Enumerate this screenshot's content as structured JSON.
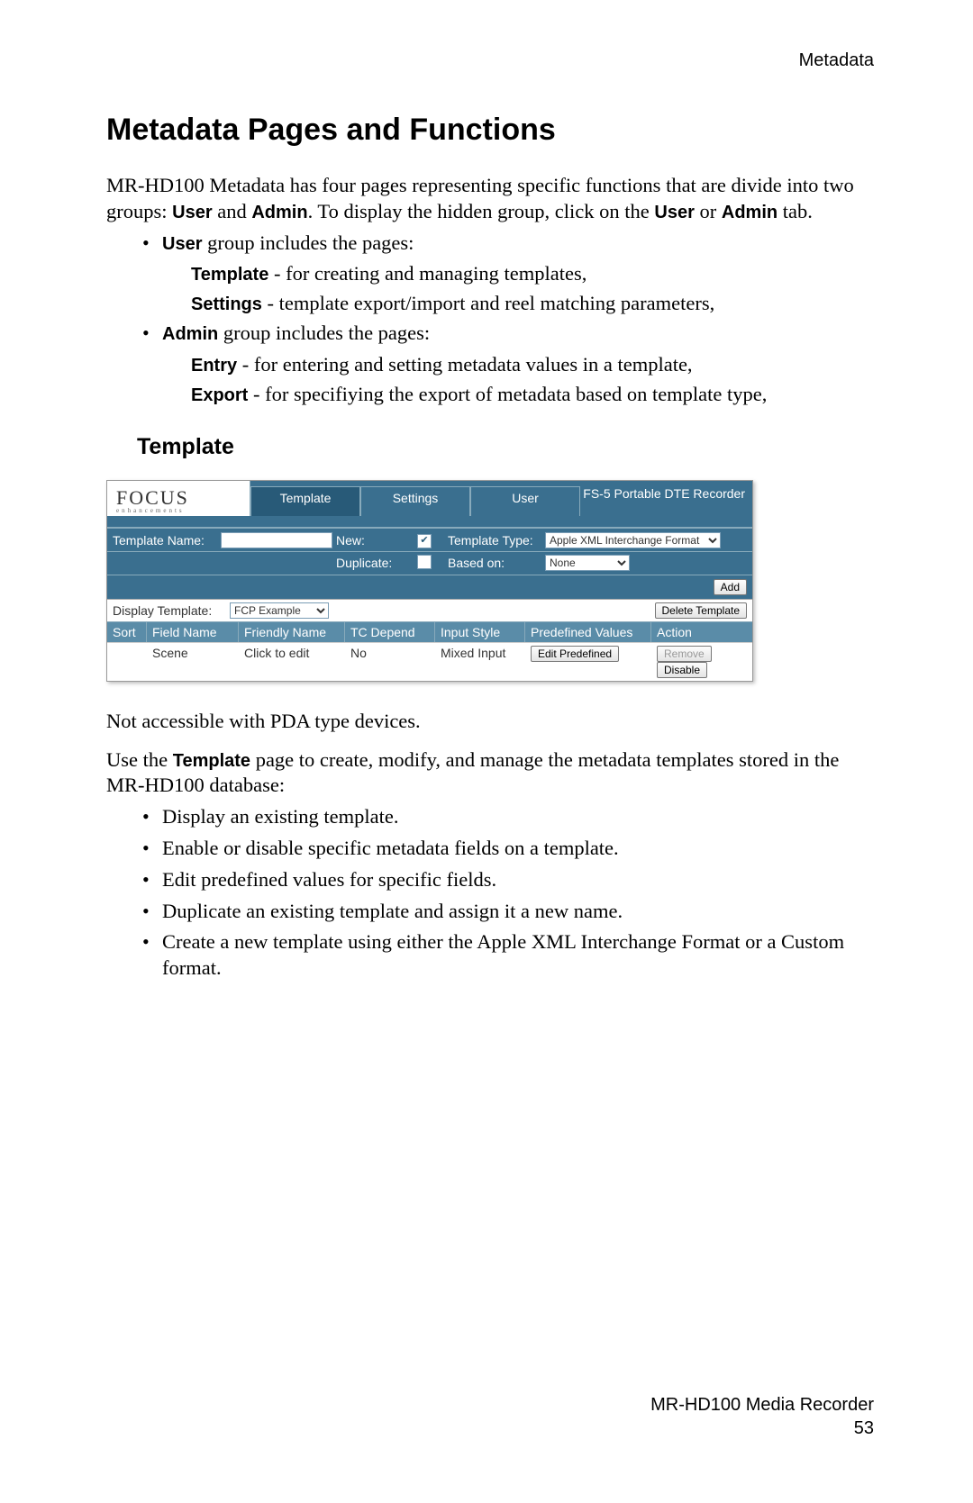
{
  "header": {
    "category": "Metadata"
  },
  "heading": "Metadata Pages and Functions",
  "intro": {
    "part1": "MR-HD100 Metadata has four pages representing specific functions that are divide into two groups: ",
    "b1": "User",
    "mid1": " and ",
    "b2": "Admin",
    "part2": ". To display the hidden group, click on the ",
    "b3": "User",
    "mid2": " or ",
    "b4": "Admin",
    "part3": " tab."
  },
  "bullet1": {
    "b": "User",
    "rest": " group includes the pages:"
  },
  "sub1a": {
    "b": "Template",
    "rest": " - for creating and managing templates,"
  },
  "sub1b": {
    "b": "Settings",
    "rest": " - template export/import and reel matching parameters,"
  },
  "bullet2": {
    "b": "Admin",
    "rest": " group includes the pages:"
  },
  "sub2a": {
    "b": "Entry",
    "rest": " - for entering and setting metadata values in a template,"
  },
  "sub2b": {
    "b": "Export",
    "rest": " - for specifiying the export of metadata based on template type,"
  },
  "subsection": "Template",
  "shot": {
    "logo_main": "FOCUS",
    "logo_tag": "enhancements",
    "tabs": {
      "template": "Template",
      "settings": "Settings",
      "user": "User"
    },
    "device": "FS-5 Portable DTE Recorder",
    "labels": {
      "template_name": "Template Name:",
      "new": "New:",
      "duplicate": "Duplicate:",
      "template_type": "Template Type:",
      "based_on": "Based on:",
      "display_template": "Display Template:"
    },
    "values": {
      "template_type": "Apple XML Interchange Format",
      "based_on": "None",
      "display_template": "FCP Example",
      "new_checked": "✔",
      "duplicate_checked": ""
    },
    "buttons": {
      "add": "Add",
      "delete_template": "Delete Template",
      "edit_predefined": "Edit Predefined",
      "remove": "Remove",
      "disable": "Disable"
    },
    "columns": {
      "sort": "Sort",
      "field_name": "Field Name",
      "friendly_name": "Friendly Name",
      "tc_depend": "TC Depend",
      "input_style": "Input Style",
      "predefined": "Predefined Values",
      "action": "Action"
    },
    "row": {
      "field_name": "Scene",
      "friendly_name": "Click to edit",
      "tc_depend": "No",
      "input_style": "Mixed Input"
    }
  },
  "after1": "Not accessible with PDA type devices.",
  "after2": {
    "pre": "Use the ",
    "b": "Template",
    "post": " page to create, modify, and manage the metadata templates stored in the MR-HD100 database:"
  },
  "list2": [
    "Display an existing template.",
    "Enable or disable specific metadata fields on a template.",
    "Edit predefined values for specific fields.",
    "Duplicate an existing template and assign it a new name.",
    "Create a new template using either the Apple XML Interchange Format or a Custom format."
  ],
  "footer": {
    "line1": "MR-HD100 Media Recorder",
    "line2": "53"
  }
}
